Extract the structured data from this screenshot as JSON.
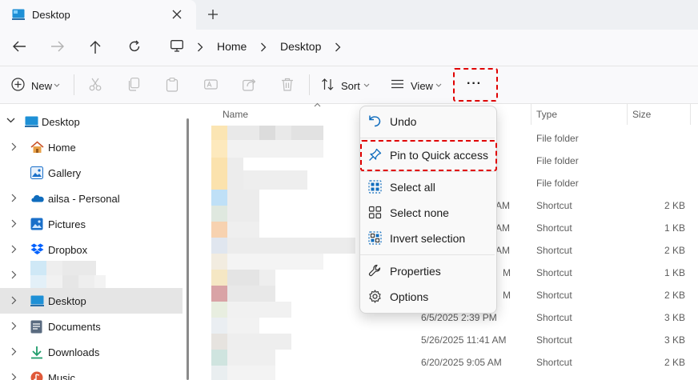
{
  "tab": {
    "title": "Desktop"
  },
  "breadcrumb": [
    "Home",
    "Desktop"
  ],
  "toolbar": {
    "new_label": "New",
    "sort_label": "Sort",
    "view_label": "View",
    "more_label": "···"
  },
  "sidebar": {
    "items": [
      {
        "label": "Desktop",
        "icon": "desktop-icon"
      },
      {
        "label": "Home",
        "icon": "home-icon"
      },
      {
        "label": "Gallery",
        "icon": "gallery-icon"
      },
      {
        "label": "ailsa - Personal",
        "icon": "onedrive-icon"
      },
      {
        "label": "Pictures",
        "icon": "pictures-icon"
      },
      {
        "label": "Dropbox",
        "icon": "dropbox-icon"
      },
      {
        "label": "",
        "icon": "redacted"
      },
      {
        "label": "Desktop",
        "icon": "desktop-icon"
      },
      {
        "label": "Documents",
        "icon": "documents-icon"
      },
      {
        "label": "Downloads",
        "icon": "downloads-icon"
      },
      {
        "label": "Music",
        "icon": "music-icon"
      }
    ]
  },
  "columns": {
    "name": "Name",
    "type": "Type",
    "size": "Size"
  },
  "rows": [
    {
      "date": "",
      "type": "File folder",
      "size": ""
    },
    {
      "date": "",
      "type": "File folder",
      "size": ""
    },
    {
      "date": "",
      "type": "File folder",
      "size": ""
    },
    {
      "date": "AM",
      "type": "Shortcut",
      "size": "2 KB"
    },
    {
      "date": "AM",
      "type": "Shortcut",
      "size": "1 KB"
    },
    {
      "date": "AM",
      "type": "Shortcut",
      "size": "2 KB"
    },
    {
      "date": "M",
      "type": "Shortcut",
      "size": "1 KB"
    },
    {
      "date": "M",
      "type": "Shortcut",
      "size": "2 KB"
    },
    {
      "date": "6/5/2025 2:39 PM",
      "type": "Shortcut",
      "size": "3 KB"
    },
    {
      "date": "5/26/2025 11:41 AM",
      "type": "Shortcut",
      "size": "3 KB"
    },
    {
      "date": "6/20/2025 9:05 AM",
      "type": "Shortcut",
      "size": "2 KB"
    }
  ],
  "menu": {
    "items": [
      {
        "label": "Undo",
        "icon": "undo-icon"
      },
      {
        "label": "Pin to Quick access",
        "icon": "pin-icon"
      },
      {
        "label": "Select all",
        "icon": "select-all-icon"
      },
      {
        "label": "Select none",
        "icon": "select-none-icon"
      },
      {
        "label": "Invert selection",
        "icon": "invert-selection-icon"
      },
      {
        "label": "Properties",
        "icon": "properties-icon"
      },
      {
        "label": "Options",
        "icon": "options-icon"
      }
    ]
  },
  "colors": {
    "highlight": "#e00000",
    "selected_bg": "#e5e5e5",
    "accent": "#0067c0"
  }
}
